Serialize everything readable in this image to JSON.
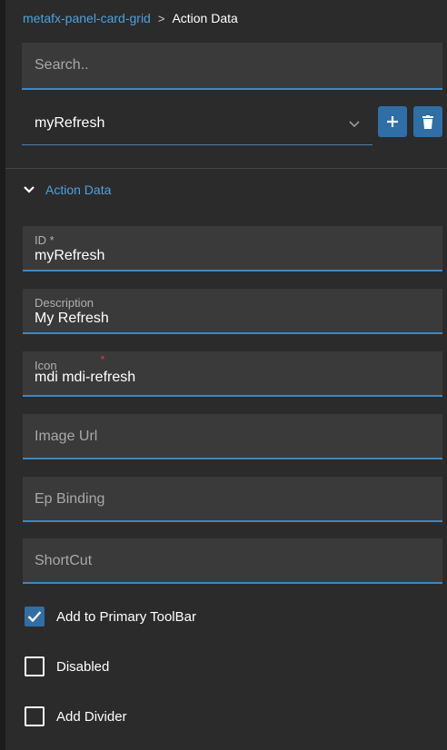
{
  "breadcrumb": {
    "parent": "metafx-panel-card-grid",
    "separator": ">",
    "current": "Action Data"
  },
  "search": {
    "placeholder": "Search..",
    "value": ""
  },
  "selector": {
    "selected": "myRefresh"
  },
  "buttons": {
    "add_icon": "plus-icon",
    "delete_icon": "trash-icon"
  },
  "section": {
    "title": "Action Data",
    "expanded": true
  },
  "fields": {
    "id": {
      "label": "ID *",
      "value": "myRefresh"
    },
    "description": {
      "label": "Description",
      "value": "My Refresh"
    },
    "icon": {
      "label": "Icon",
      "required_mark": "*",
      "value": "mdi mdi-refresh"
    },
    "image_url": {
      "placeholder": "Image Url"
    },
    "ep_binding": {
      "placeholder": "Ep Binding"
    },
    "shortcut": {
      "placeholder": "ShortCut"
    }
  },
  "checkboxes": [
    {
      "label": "Add to Primary ToolBar",
      "checked": true
    },
    {
      "label": "Disabled",
      "checked": false
    },
    {
      "label": "Add Divider",
      "checked": false
    }
  ],
  "colors": {
    "accent": "#2f6ea6",
    "link": "#4aa3df",
    "background": "#2b2b2b",
    "field_bg": "#3a3a3a",
    "required": "#e53935"
  }
}
